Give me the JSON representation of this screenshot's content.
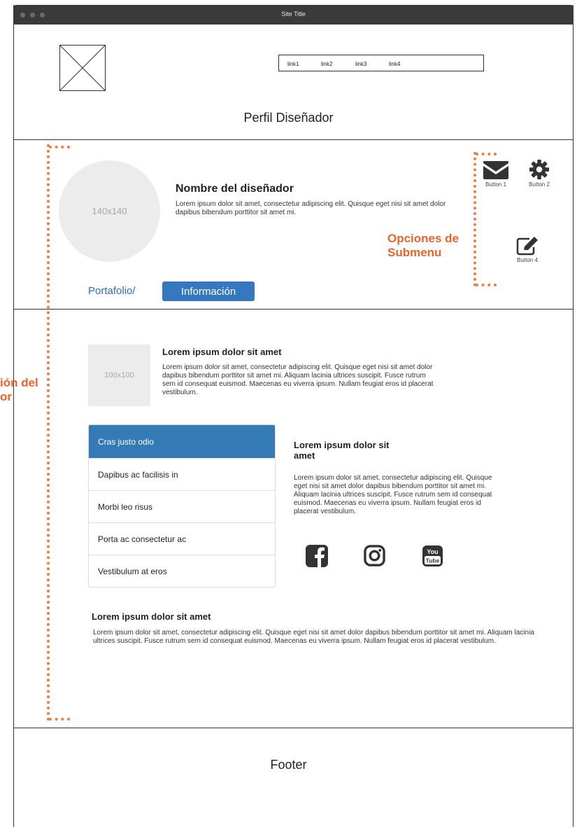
{
  "window": {
    "title": "Site Title"
  },
  "nav": {
    "links": [
      "link1",
      "link2",
      "link3",
      "link4"
    ]
  },
  "header": {
    "title": "Perfil Diseñador"
  },
  "profile": {
    "avatar_text": "140x140",
    "name": "Nombre del diseñador",
    "description": "Lorem ipsum dolor sit amet, consectetur adipiscing elit. Quisque eget nisi sit amet dolor dapibus bibendum porttitor sit amet mi.",
    "tab_portfolio": "Portafolio/",
    "tab_info": "Información"
  },
  "buttons": {
    "b1": "Button 1",
    "b2": "Button 2",
    "b4": "Button 4"
  },
  "annotations": {
    "submenu": "Opciones de\nSubmenu",
    "info_partial": "ión del\nor"
  },
  "section1": {
    "thumb_text": "100x100",
    "title": "Lorem ipsum dolor sit amet",
    "text": "Lorem ipsum dolor sit amet, consectetur adipiscing elit. Quisque eget nisi sit amet dolor dapibus bibendum porttitor sit amet mi. Aliquam lacinia ultrices suscipit. Fusce rutrum sem id consequat euismod. Maecenas eu viverra ipsum. Nullam feugiat eros id placerat vestibulum."
  },
  "list": {
    "items": [
      "Cras justo odio",
      "Dapibus ac facilisis in",
      "Morbi leo risus",
      "Porta ac consectetur ac",
      "Vestibulum at eros"
    ]
  },
  "section2": {
    "title": "Lorem ipsum dolor sit amet",
    "text": "Lorem ipsum dolor sit amet, consectetur adipiscing elit. Quisque eget nisi sit amet dolor dapibus bibendum porttitor sit amet mi. Aliquam lacinia ultrices suscipit. Fusce rutrum sem id consequat euismod. Maecenas eu viverra ipsum. Nullam feugiat eros id placerat vestibulum."
  },
  "social": {
    "youtube_top": "You",
    "youtube_bottom": "Tube"
  },
  "section3": {
    "title": "Lorem ipsum dolor sit amet",
    "text": "Lorem ipsum dolor sit amet, consectetur adipiscing elit. Quisque eget nisi sit amet dolor dapibus bibendum porttitor sit amet mi. Aliquam lacinia ultrices suscipit. Fusce rutrum sem id consequat euismod. Maecenas eu viverra ipsum. Nullam feugiat eros id placerat vestibulum."
  },
  "footer": {
    "text": "Footer"
  },
  "colors": {
    "accent": "#337ab7",
    "annotation": "#e8642c",
    "titlebar": "#3a3a3a",
    "placeholder": "#ececec"
  }
}
